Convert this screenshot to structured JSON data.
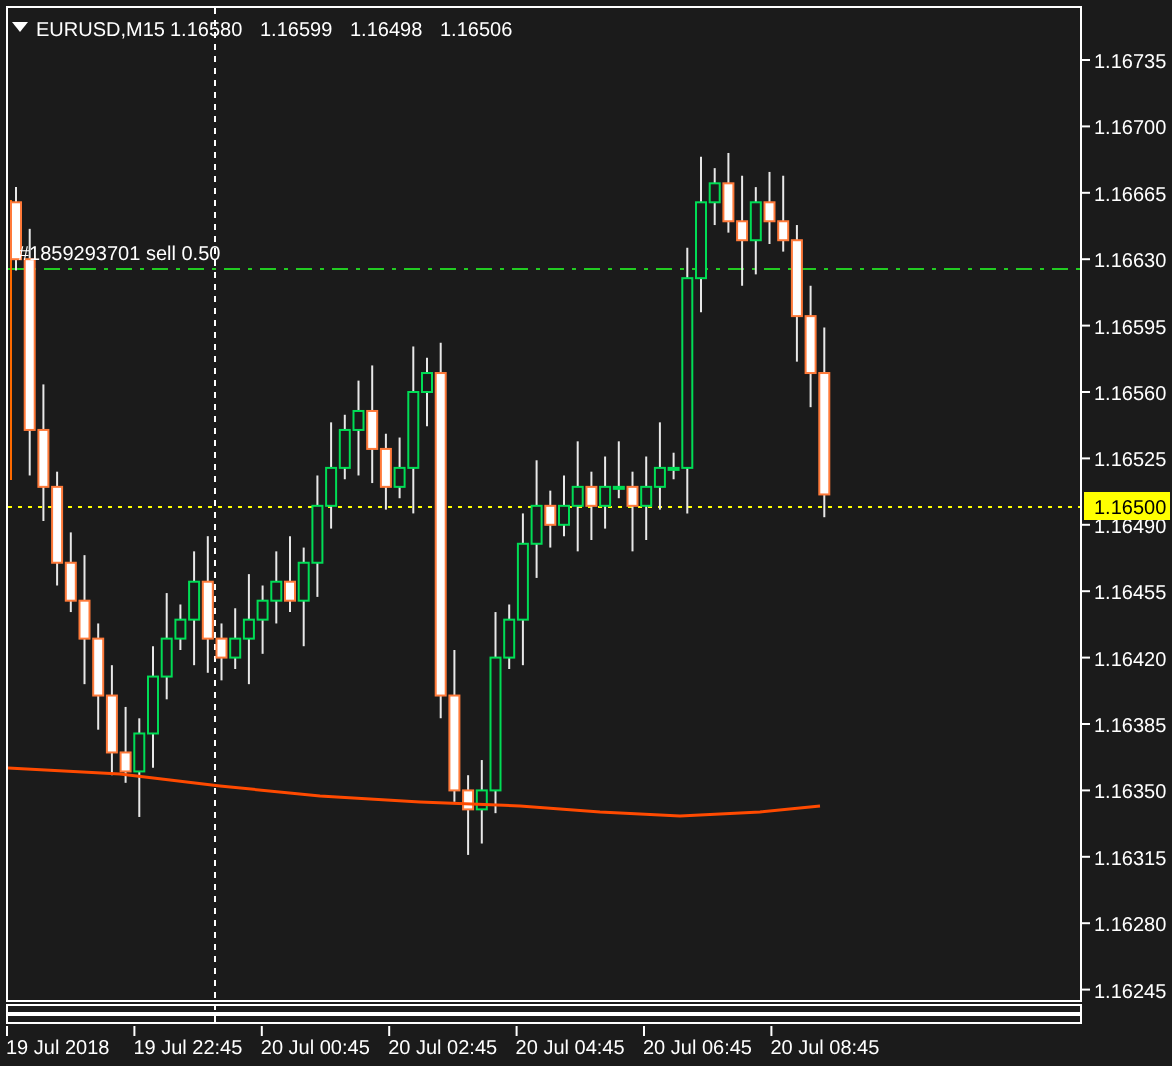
{
  "header": {
    "symbol": "EURUSD,M15",
    "quote": [
      "1.16580",
      "1.16599",
      "1.16498",
      "1.16506"
    ]
  },
  "order_line": {
    "label": "#1859293701 sell 0.50"
  },
  "price_axis": {
    "ticks": [
      "1.16735",
      "1.16700",
      "1.16665",
      "1.16630",
      "1.16595",
      "1.16560",
      "1.16525",
      "1.16490",
      "1.16455",
      "1.16420",
      "1.16385",
      "1.16350",
      "1.16315",
      "1.16280",
      "1.16245"
    ],
    "current_price": "1.16500"
  },
  "time_axis": {
    "labels": [
      "19 Jul 2018",
      "19 Jul 22:45",
      "20 Jul 00:45",
      "20 Jul 02:45",
      "20 Jul 04:45",
      "20 Jul 06:45",
      "20 Jul 08:45"
    ]
  }
}
